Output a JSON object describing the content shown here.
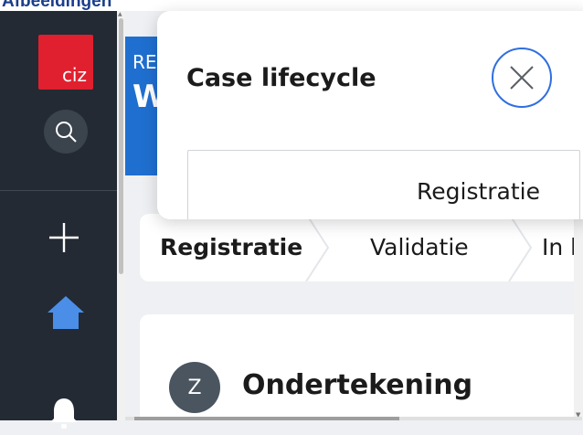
{
  "window": {
    "caption": "Afbeeldingen"
  },
  "sidebar": {
    "logo_text": "ciz",
    "items": [
      {
        "name": "search",
        "icon": "search-icon"
      },
      {
        "name": "add",
        "icon": "plus-icon"
      },
      {
        "name": "home",
        "icon": "home-icon"
      },
      {
        "name": "notifications",
        "icon": "bell-icon"
      }
    ]
  },
  "header": {
    "crumb_partial": "RE",
    "title_partial": "W"
  },
  "stepper": {
    "steps": [
      "Registratie",
      "Validatie",
      "In b"
    ],
    "active_index": 0
  },
  "card": {
    "avatar_letter": "Z",
    "title": "Ondertekening"
  },
  "popup": {
    "title": "Case lifecycle",
    "close_icon": "close-icon",
    "current_step": "Registratie"
  },
  "colors": {
    "sidebar_bg": "#232a33",
    "brand_red": "#e0202e",
    "home_blue": "#4a8ee8",
    "header_blue": "#1f6fd1",
    "close_ring": "#2f6fe0"
  }
}
